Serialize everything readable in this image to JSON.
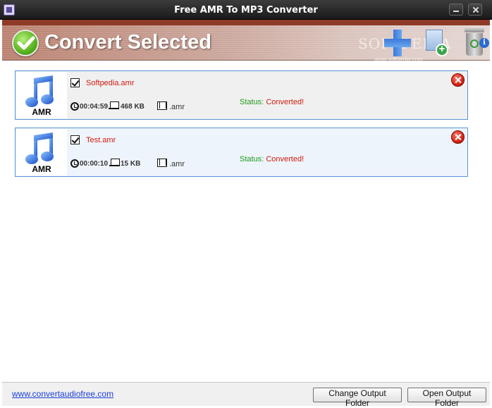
{
  "window": {
    "title": "Free AMR To MP3 Converter"
  },
  "toolbar": {
    "convert_label": "Convert Selected",
    "watermark": "SOFTPEDIA",
    "watermark_url": "www.softpedia.com",
    "info_label": "i"
  },
  "files": [
    {
      "thumb_label": "AMR",
      "name": "Softpedia.amr",
      "checked": true,
      "duration": "00:04:59",
      "size": "468 KB",
      "format": ".amr",
      "status_label": "Status:",
      "status_value": "Converted!"
    },
    {
      "thumb_label": "AMR",
      "name": "Test.amr",
      "checked": true,
      "duration": "00:00:10",
      "size": "15 KB",
      "format": ".amr",
      "status_label": "Status:",
      "status_value": "Converted!"
    }
  ],
  "footer": {
    "website": "www.convertaudiofree.com",
    "change_output_folder": "Change Output Folder",
    "open_output_folder": "Open Output Folder"
  },
  "colors": {
    "file_name": "#d21a0e",
    "status_label": "#1e9a1e",
    "status_value": "#d21a0e",
    "item_border": "#5a94d8",
    "link": "#1a3fd8"
  }
}
